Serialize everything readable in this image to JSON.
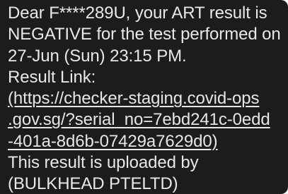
{
  "message": {
    "lines": {
      "l1": "Dear F****289U, your ART result is",
      "l2": "NEGATIVE for the test performed on",
      "l3": "27-Jun (Sun) 23:15 PM.",
      "l4": "Result Link:"
    },
    "link": {
      "l1": "(https://checker-staging.covid-ops",
      "l2": ".gov.sg/?serial_no=7ebd241c-0edd",
      "l3": "-401a-8d6b-07429a7629d0)"
    },
    "footer": {
      "l1": "This result is uploaded by",
      "l2": "(BULKHEAD PTELTD)"
    }
  }
}
